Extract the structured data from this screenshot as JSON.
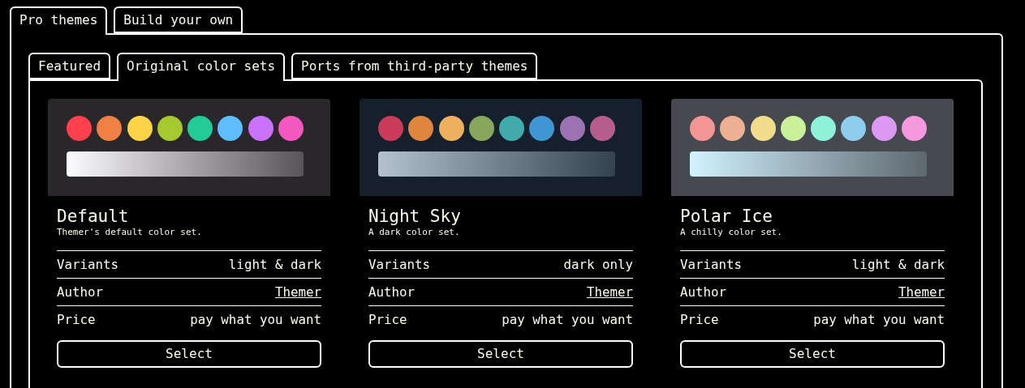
{
  "outer_tabs": [
    {
      "label": "Pro themes",
      "selected": true
    },
    {
      "label": "Build your own",
      "selected": false
    }
  ],
  "inner_tabs": [
    {
      "label": "Featured",
      "selected": false
    },
    {
      "label": "Original color sets",
      "selected": true
    },
    {
      "label": "Ports from third-party themes",
      "selected": false
    }
  ],
  "themes": [
    {
      "name": "Default",
      "description": "Themer's default color set.",
      "swatches": [
        {
          "color": "#fe414d"
        },
        {
          "color": "#ef8145"
        },
        {
          "color": "#ffd348"
        },
        {
          "color": "#a6c92f"
        },
        {
          "color": "#23cb97"
        },
        {
          "color": "#5fbdfe"
        },
        {
          "color": "#cb72fc"
        },
        {
          "color": "#f457c0"
        }
      ],
      "rows": [
        {
          "label": "Variants",
          "value": "light & dark",
          "kind": "text"
        },
        {
          "label": "Author",
          "value": "Themer",
          "kind": "link"
        },
        {
          "label": "Price",
          "value": "pay what you want",
          "kind": "text"
        }
      ],
      "button": "Select"
    },
    {
      "name": "Night Sky",
      "description": "A dark color set.",
      "swatches": [
        {
          "color": "#cb3b5c"
        },
        {
          "color": "#de853f"
        },
        {
          "color": "#ecb05f"
        },
        {
          "color": "#88a65c"
        },
        {
          "color": "#40aba9"
        },
        {
          "color": "#4096d2"
        },
        {
          "color": "#9c72b3"
        },
        {
          "color": "#b65d8e"
        }
      ],
      "rows": [
        {
          "label": "Variants",
          "value": "dark only",
          "kind": "text"
        },
        {
          "label": "Author",
          "value": "Themer",
          "kind": "link"
        },
        {
          "label": "Price",
          "value": "pay what you want",
          "kind": "text"
        }
      ],
      "button": "Select"
    },
    {
      "name": "Polar Ice",
      "description": "A chilly color set.",
      "swatches": [
        {
          "color": "#f39695"
        },
        {
          "color": "#eeb093"
        },
        {
          "color": "#f2dd8e"
        },
        {
          "color": "#cbf09a"
        },
        {
          "color": "#8ef2d9"
        },
        {
          "color": "#8fcdee"
        },
        {
          "color": "#dd98f4"
        },
        {
          "color": "#f598df"
        }
      ],
      "rows": [
        {
          "label": "Variants",
          "value": "light & dark",
          "kind": "text"
        },
        {
          "label": "Author",
          "value": "Themer",
          "kind": "link"
        },
        {
          "label": "Price",
          "value": "pay what you want",
          "kind": "text"
        }
      ],
      "button": "Select"
    }
  ]
}
